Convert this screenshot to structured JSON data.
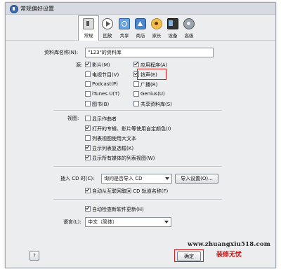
{
  "window": {
    "title": "常规偏好设置"
  },
  "toolbar": {
    "items": [
      {
        "label": "常规",
        "icon": "general-settings-icon"
      },
      {
        "label": "回放",
        "icon": "playback-icon"
      },
      {
        "label": "共享",
        "icon": "sharing-icon"
      },
      {
        "label": "商店",
        "icon": "store-icon"
      },
      {
        "label": "家长",
        "icon": "parental-icon"
      },
      {
        "label": "设备",
        "icon": "device-icon"
      },
      {
        "label": "高级",
        "icon": "advanced-icon"
      }
    ]
  },
  "library": {
    "label": "资料库名称(N):",
    "value": "\"123\"的资料库"
  },
  "sources": {
    "label": "源:",
    "items": [
      {
        "label": "影片(M)",
        "checked": true
      },
      {
        "label": "应用程序(A)",
        "checked": true
      },
      {
        "label": "电视节目(V)",
        "checked": false
      },
      {
        "label": "铃声(E)",
        "checked": true
      },
      {
        "label": "Podcast(P)",
        "checked": false
      },
      {
        "label": "广播(R)",
        "checked": false
      },
      {
        "label": "iTunes U(T)",
        "checked": false
      },
      {
        "label": "Genius(U)",
        "checked": false
      },
      {
        "label": "图书(B)",
        "checked": false
      },
      {
        "label": "共享资料库(S)",
        "checked": false
      }
    ]
  },
  "views": {
    "label": "视图:",
    "items": [
      {
        "label": "显示作曲者",
        "checked": false
      },
      {
        "label": "打开的专辑、影片等使用自定颜色(I)",
        "checked": true
      },
      {
        "label": "列表视图使用大文本",
        "checked": false
      },
      {
        "label": "显示列表复选框(K)",
        "checked": true
      },
      {
        "label": "显示所有媒体的列表视图(W)",
        "checked": true
      }
    ]
  },
  "cd": {
    "label": "插入 CD 时(C):",
    "value": "询问是否导入 CD",
    "import_button": "导入设置(O)...",
    "auto_fetch": {
      "label": "自动从互联网取回 CD 轨道名称(F)",
      "checked": true
    }
  },
  "updates": {
    "label": "自动检查新软件更新(H)",
    "checked": true
  },
  "language": {
    "label": "语言(L):",
    "value": "中文（简体）"
  },
  "footer": {
    "help": "?",
    "ok": "确定"
  },
  "watermark": {
    "url": "www.zhuangxiu518.com",
    "text": "装修无忧"
  },
  "colors": {
    "highlight": "#d61e1e",
    "window_bg": "#ecedef"
  }
}
